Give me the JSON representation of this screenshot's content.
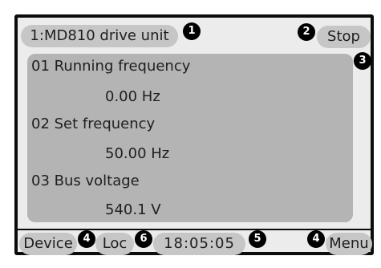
{
  "header": {
    "device_label": "1:MD810 drive unit",
    "status_button": "Stop"
  },
  "callouts": {
    "one": "1",
    "two": "2",
    "three": "3",
    "four_a": "4",
    "six": "6",
    "five": "5",
    "four_b": "4"
  },
  "parameters": [
    {
      "name": "01 Running frequency",
      "value": "0.00 Hz"
    },
    {
      "name": "02 Set frequency",
      "value": "50.00 Hz"
    },
    {
      "name": "03 Bus voltage",
      "value": "540.1 V"
    }
  ],
  "footer": {
    "device_button": "Device",
    "loc_button": "Loc",
    "clock": "18:05:05",
    "menu_button": "Menu"
  },
  "colors": {
    "screen_bg": "#ececec",
    "panel_bg": "#b4b4b4",
    "pill_bg": "#c6c6c6",
    "frame": "#0c0c0c",
    "badge": "#000000"
  }
}
